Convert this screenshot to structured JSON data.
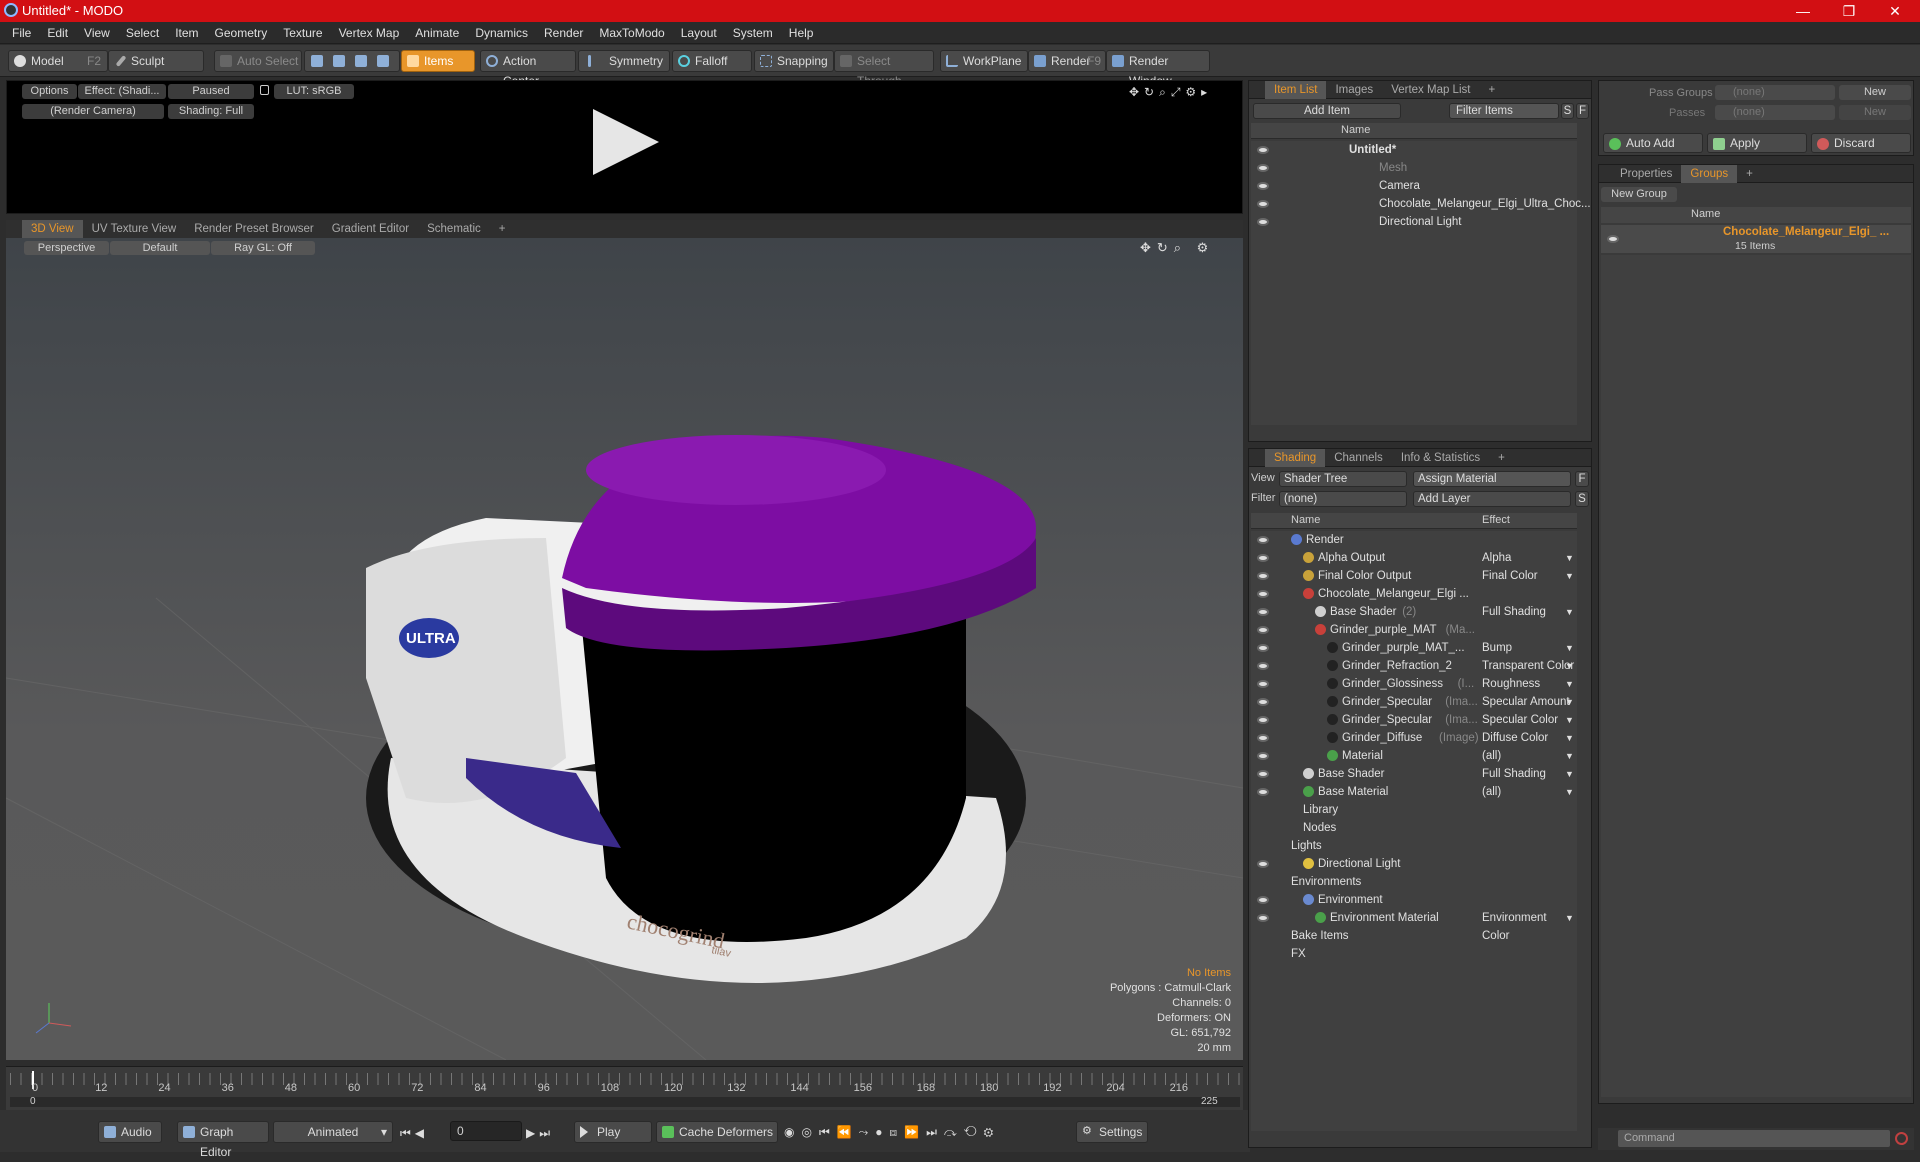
{
  "window": {
    "title": "Untitled* - MODO",
    "controls": [
      "—",
      "❐",
      "✕"
    ]
  },
  "menu": [
    "File",
    "Edit",
    "View",
    "Select",
    "Item",
    "Geometry",
    "Texture",
    "Vertex Map",
    "Animate",
    "Dynamics",
    "Render",
    "MaxToModo",
    "Layout",
    "System",
    "Help"
  ],
  "toolbar": {
    "model": "Model",
    "model_key": "F2",
    "sculpt": "Sculpt",
    "auto_select": "Auto Select",
    "items": "Items",
    "action_center": "Action Center",
    "symmetry": "Symmetry",
    "falloff": "Falloff",
    "snapping": "Snapping",
    "select_through": "Select Through",
    "workplane": "WorkPlane",
    "render": "Render",
    "render_key": "F9",
    "render_window": "Render Window"
  },
  "preview": {
    "options": "Options",
    "effect": "Effect: (Shadi...",
    "paused": "Paused",
    "lut": "LUT: sRGB",
    "camera": "(Render Camera)",
    "shading": "Shading: Full"
  },
  "viewport_tabs": [
    "3D View",
    "UV Texture View",
    "Render Preset Browser",
    "Gradient Editor",
    "Schematic"
  ],
  "viewport": {
    "perspective": "Perspective",
    "default": "Default",
    "raygl": "Ray GL: Off",
    "status": {
      "no_items": "No Items",
      "polygons": "Polygons : Catmull-Clark",
      "channels": "Channels: 0",
      "deformers": "Deformers: ON",
      "gl": "GL: 651,792",
      "scale": "20 mm"
    },
    "model_logo": "ULTRA",
    "model_brand": "chocogrind",
    "model_brand_sub": "tilav"
  },
  "timeline": {
    "ticks": [
      "0",
      "12",
      "24",
      "36",
      "48",
      "60",
      "72",
      "84",
      "96",
      "108",
      "120",
      "132",
      "144",
      "156",
      "168",
      "180",
      "192",
      "204",
      "216"
    ],
    "start": "0",
    "end": "225"
  },
  "bottombar": {
    "audio": "Audio",
    "graph_editor": "Graph Editor",
    "animated": "Animated",
    "frame": "0",
    "play": "Play",
    "cache_deformers": "Cache Deformers",
    "settings": "Settings"
  },
  "item_list": {
    "tabs": [
      "Item List",
      "Images",
      "Vertex Map List"
    ],
    "add_item": "Add Item",
    "filter_items": "Filter Items",
    "s": "S",
    "f": "F",
    "col_name": "Name",
    "rows": [
      {
        "label": "Untitled*",
        "indent": 0
      },
      {
        "label": "Mesh",
        "indent": 1
      },
      {
        "label": "Camera",
        "indent": 1
      },
      {
        "label": "Chocolate_Melangeur_Elgi_Ultra_Choc...",
        "indent": 1
      },
      {
        "label": "Directional Light",
        "indent": 1
      }
    ]
  },
  "shading": {
    "tabs": [
      "Shading",
      "Channels",
      "Info & Statistics"
    ],
    "view_label": "View",
    "view_value": "Shader Tree",
    "assign_material": "Assign Material",
    "f": "F",
    "filter_label": "Filter",
    "filter_value": "(none)",
    "add_layer": "Add Layer",
    "s": "S",
    "col_name": "Name",
    "col_effect": "Effect",
    "rows": [
      {
        "name": "Render",
        "sub": "",
        "effect": "",
        "indent": 0,
        "icon": "#5a7ad0"
      },
      {
        "name": "Alpha Output",
        "sub": "",
        "effect": "Alpha",
        "indent": 1,
        "icon": "#c9a23a"
      },
      {
        "name": "Final Color Output",
        "sub": "",
        "effect": "Final Color",
        "indent": 1,
        "icon": "#c9a23a"
      },
      {
        "name": "Chocolate_Melangeur_Elgi ...",
        "sub": "",
        "effect": "",
        "indent": 1,
        "icon": "#c8403a"
      },
      {
        "name": "Base Shader",
        "sub": "(2)",
        "effect": "Full Shading",
        "indent": 2,
        "icon": "#cfcfcf"
      },
      {
        "name": "Grinder_purple_MAT",
        "sub": "(Ma...",
        "effect": "",
        "indent": 2,
        "icon": "#c8403a"
      },
      {
        "name": "Grinder_purple_MAT_...",
        "sub": "",
        "effect": "Bump",
        "indent": 3,
        "icon": "#222"
      },
      {
        "name": "Grinder_Refraction_2",
        "sub": "",
        "effect": "Transparent Color",
        "indent": 3,
        "icon": "#222"
      },
      {
        "name": "Grinder_Glossiness",
        "sub": "(I...",
        "effect": "Roughness",
        "indent": 3,
        "icon": "#222"
      },
      {
        "name": "Grinder_Specular",
        "sub": "(Ima...",
        "effect": "Specular Amount",
        "indent": 3,
        "icon": "#222"
      },
      {
        "name": "Grinder_Specular",
        "sub": "(Ima...",
        "effect": "Specular Color",
        "indent": 3,
        "icon": "#222"
      },
      {
        "name": "Grinder_Diffuse",
        "sub": "(Image)",
        "effect": "Diffuse Color",
        "indent": 3,
        "icon": "#222"
      },
      {
        "name": "Material",
        "sub": "",
        "effect": "(all)",
        "indent": 3,
        "icon": "#4aa04a"
      },
      {
        "name": "Base Shader",
        "sub": "",
        "effect": "Full Shading",
        "indent": 1,
        "icon": "#cfcfcf"
      },
      {
        "name": "Base Material",
        "sub": "",
        "effect": "(all)",
        "indent": 1,
        "icon": "#4aa04a"
      },
      {
        "name": "Library",
        "sub": "",
        "effect": "",
        "indent": 1,
        "icon": ""
      },
      {
        "name": "Nodes",
        "sub": "",
        "effect": "",
        "indent": 1,
        "icon": ""
      },
      {
        "name": "Lights",
        "sub": "",
        "effect": "",
        "indent": 0,
        "icon": ""
      },
      {
        "name": "Directional Light",
        "sub": "",
        "effect": "",
        "indent": 1,
        "icon": "#e0c040"
      },
      {
        "name": "Environments",
        "sub": "",
        "effect": "",
        "indent": 0,
        "icon": ""
      },
      {
        "name": "Environment",
        "sub": "",
        "effect": "",
        "indent": 1,
        "icon": "#6a8ad0"
      },
      {
        "name": "Environment Material",
        "sub": "",
        "effect": "Environment Color",
        "indent": 2,
        "icon": "#4aa04a"
      },
      {
        "name": "Bake Items",
        "sub": "",
        "effect": "",
        "indent": 0,
        "icon": ""
      },
      {
        "name": "FX",
        "sub": "",
        "effect": "",
        "indent": 0,
        "icon": ""
      }
    ]
  },
  "passes": {
    "pass_groups": "Pass Groups",
    "passes": "Passes",
    "none": "(none)",
    "new": "New",
    "auto_add": "Auto Add",
    "apply": "Apply",
    "discard": "Discard"
  },
  "groups": {
    "tabs": [
      "Properties",
      "Groups"
    ],
    "new_group": "New Group",
    "col_name": "Name",
    "group_name": "Chocolate_Melangeur_Elgi_ ...",
    "group_count": "15 Items"
  },
  "command": {
    "placeholder": "Command"
  },
  "colors": {
    "accent": "#e8962a",
    "title_red": "#d20f13",
    "lid_purple": "#7d0da3"
  }
}
